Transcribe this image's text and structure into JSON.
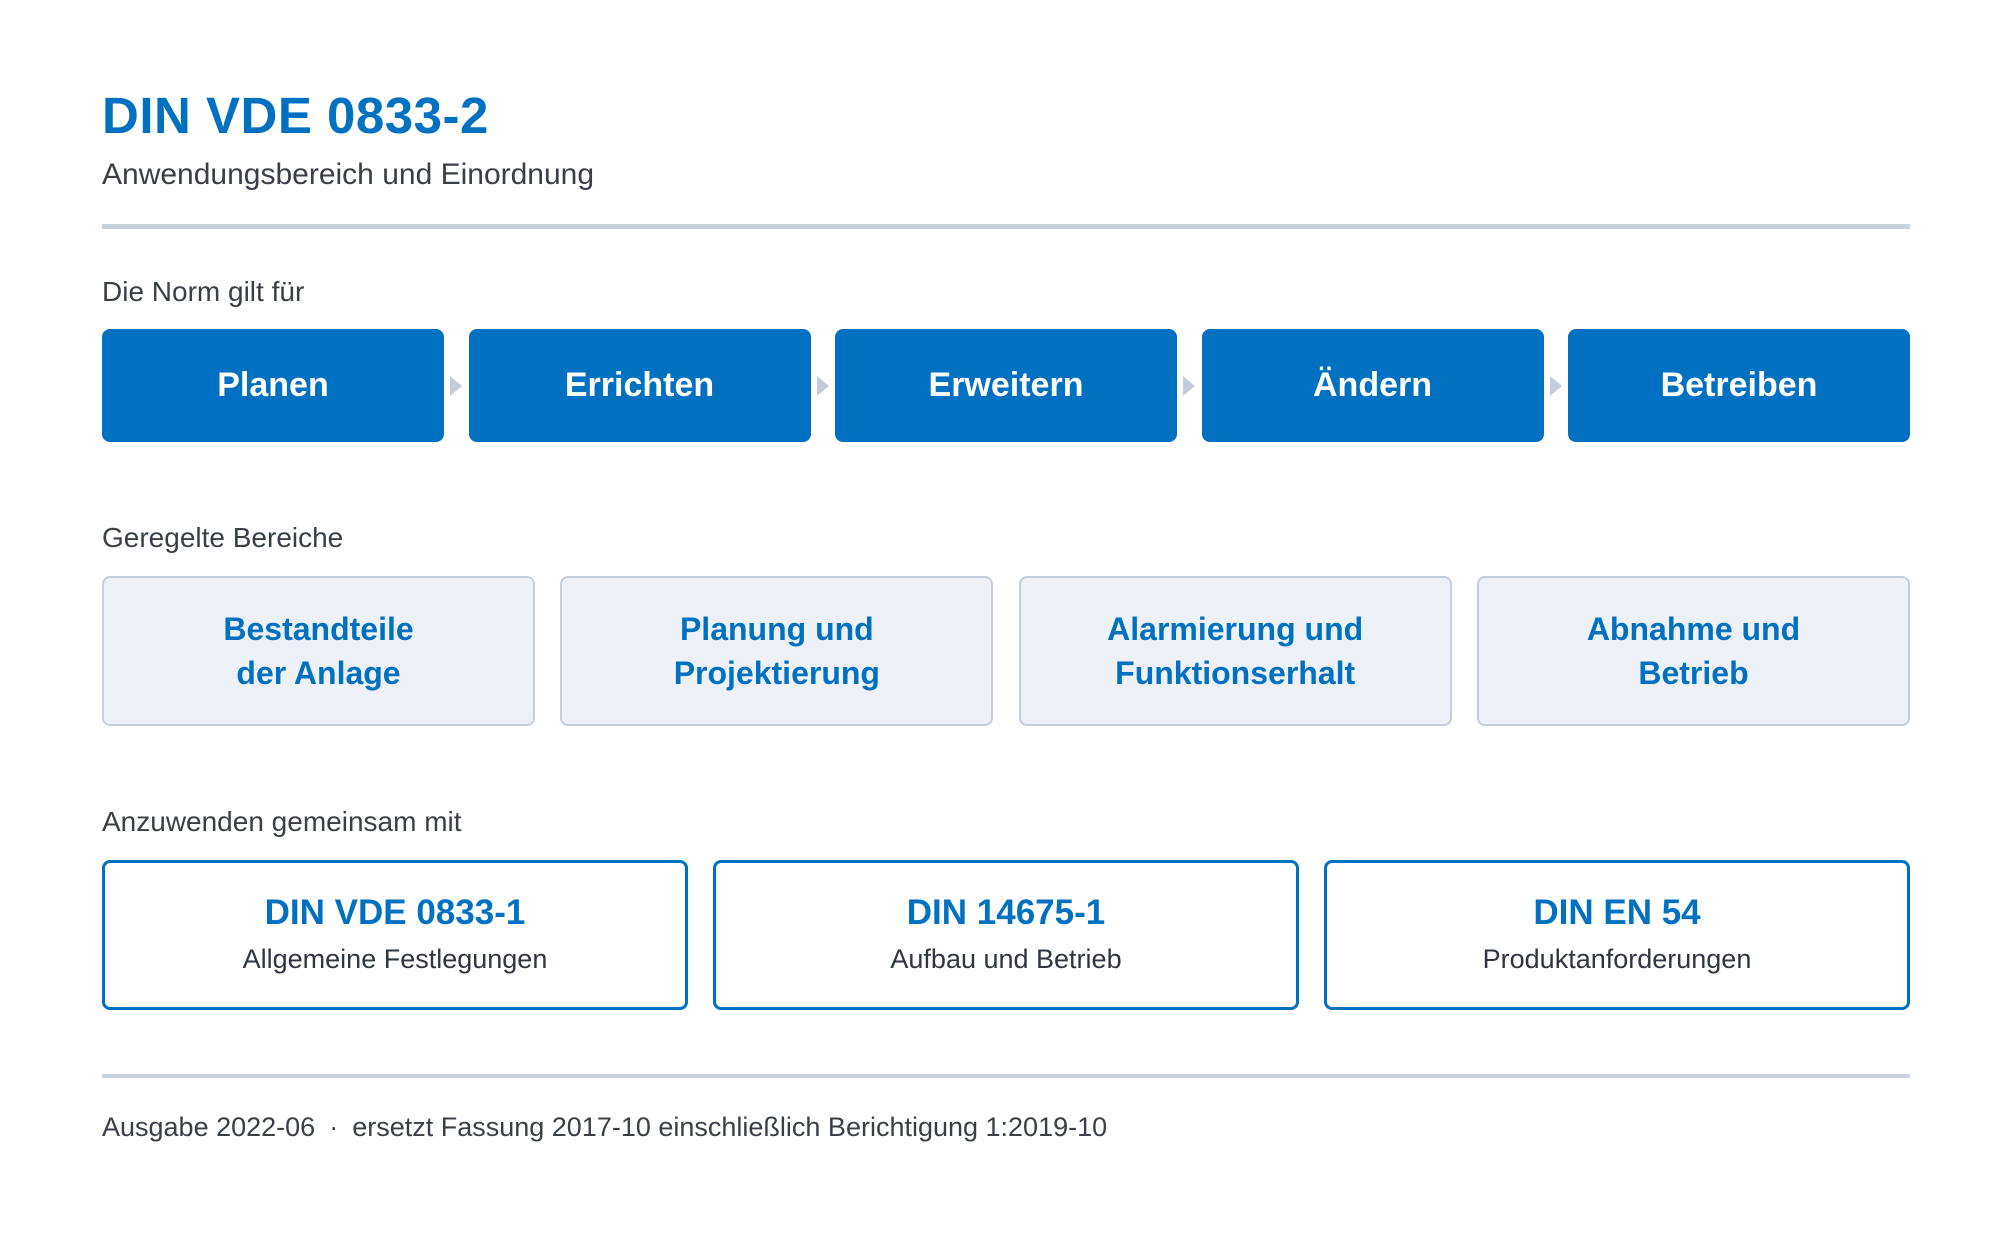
{
  "header": {
    "title": "DIN VDE 0833-2",
    "subtitle": "Anwendungsbereich und Einordnung"
  },
  "scope": {
    "label": "Die Norm gilt für",
    "steps": [
      "Planen",
      "Errichten",
      "Erweitern",
      "Ändern",
      "Betreiben"
    ]
  },
  "areas": {
    "label": "Geregelte Bereiche",
    "items": [
      {
        "line1": "Bestandteile",
        "line2": "der Anlage"
      },
      {
        "line1": "Planung und",
        "line2": "Projektierung"
      },
      {
        "line1": "Alarmierung und",
        "line2": "Funktionserhalt"
      },
      {
        "line1": "Abnahme und",
        "line2": "Betrieb"
      }
    ]
  },
  "related": {
    "label": "Anzuwenden gemeinsam mit",
    "items": [
      {
        "code": "DIN VDE 0833-1",
        "desc": "Allgemeine Festlegungen"
      },
      {
        "code": "DIN 14675-1",
        "desc": "Aufbau und Betrieb"
      },
      {
        "code": "DIN EN 54",
        "desc": "Produktanforderungen"
      }
    ]
  },
  "footer": {
    "edition": "Ausgabe 2022-06",
    "separator": "·",
    "replaces": "ersetzt Fassung 2017-10 einschließlich Berichtigung 1:2019-10"
  },
  "colors": {
    "primary": "#0070c0",
    "area_fill": "#eef2f8",
    "area_border": "#c5cfdc",
    "rule": "#c9d2dd",
    "arrow": "#c3ccd8"
  }
}
